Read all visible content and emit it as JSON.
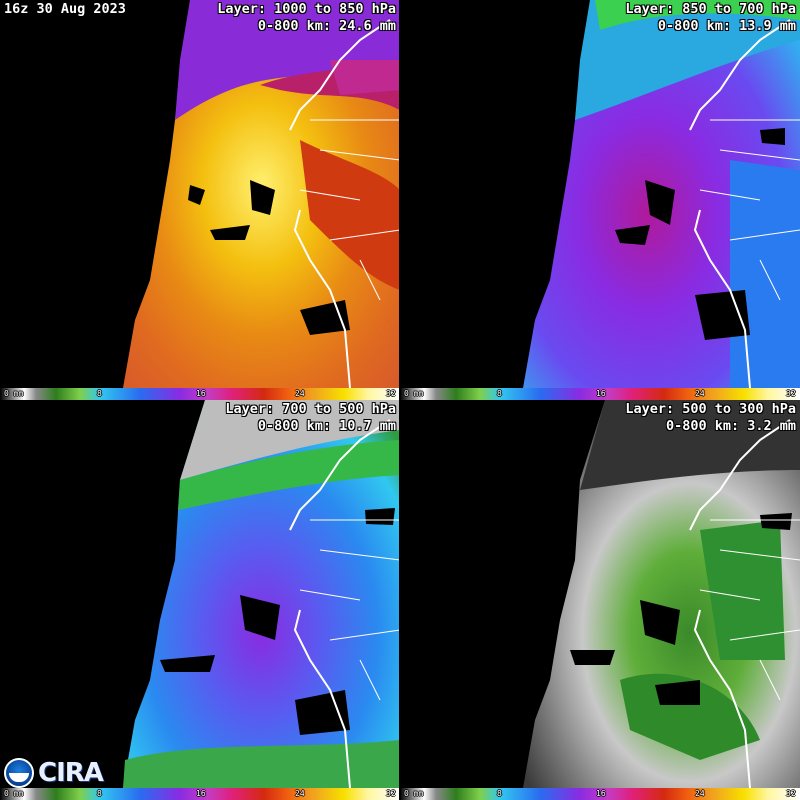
{
  "timestamp": "16z 30 Aug 2023",
  "panels": [
    {
      "layer": "Layer: 1000 to 850 hPa",
      "mean": "0-800 km: 24.6 mm",
      "palette": "warm"
    },
    {
      "layer": "Layer: 850 to 700 hPa",
      "mean": "0-800 km: 13.9 mm",
      "palette": "purple"
    },
    {
      "layer": "Layer: 700 to 500 hPa",
      "mean": "0-800 km: 10.7 mm",
      "palette": "blue"
    },
    {
      "layer": "Layer: 500 to 300 hPa",
      "mean": "0-800 km: 3.2 mm",
      "palette": "gray"
    }
  ],
  "colorbar": {
    "unit_label": "0 mm",
    "ticks": [
      "8",
      "16",
      "24",
      "32"
    ]
  },
  "logos": {
    "agency_icon": "noaa-logo-icon",
    "org_text": "CIRA"
  }
}
